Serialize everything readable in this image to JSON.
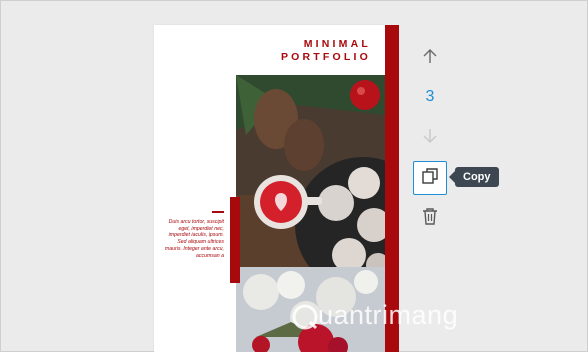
{
  "page": {
    "title_line1": "MINIMAL",
    "title_line2": "PORTFOLIO",
    "body_text": "Duis arcu tortor, suscipit eget, imperdiet nec, imperdiet iaculis, ipsum. Sed aliquam ultrices mauris. Integer ante arcu, accumsan a"
  },
  "toolbar": {
    "page_number": "3",
    "copy_tooltip": "Copy",
    "icons": [
      "arrow-up-icon",
      "arrow-down-icon",
      "copy-icon",
      "trash-icon"
    ]
  },
  "watermark": {
    "text": "uantrimang"
  },
  "colors": {
    "accent_red": "#a8090c",
    "accent_blue": "#1e8ed6",
    "tooltip_bg": "#3c4752"
  }
}
